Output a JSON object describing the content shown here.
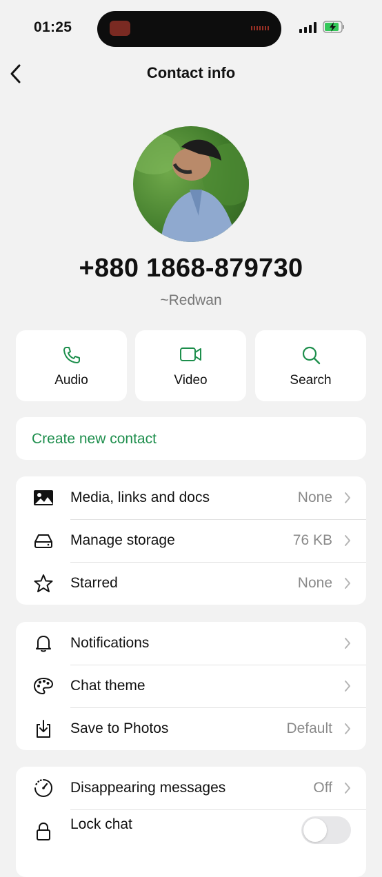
{
  "status_bar": {
    "time": "01:25"
  },
  "header": {
    "title": "Contact info"
  },
  "profile": {
    "phone": "+880 1868-879730",
    "name": "~Redwan"
  },
  "actions": [
    {
      "label": "Audio",
      "icon": "phone-icon"
    },
    {
      "label": "Video",
      "icon": "video-icon"
    },
    {
      "label": "Search",
      "icon": "search-icon"
    }
  ],
  "create_contact": {
    "label": "Create new contact"
  },
  "section1": [
    {
      "label": "Media, links and docs",
      "value": "None",
      "icon": "image-icon"
    },
    {
      "label": "Manage storage",
      "value": "76 KB",
      "icon": "storage-icon"
    },
    {
      "label": "Starred",
      "value": "None",
      "icon": "star-icon"
    }
  ],
  "section2": [
    {
      "label": "Notifications",
      "value": "",
      "icon": "bell-icon"
    },
    {
      "label": "Chat theme",
      "value": "",
      "icon": "palette-icon"
    },
    {
      "label": "Save to Photos",
      "value": "Default",
      "icon": "download-icon"
    }
  ],
  "section3": [
    {
      "label": "Disappearing messages",
      "value": "Off",
      "icon": "timer-icon"
    },
    {
      "label": "Lock chat",
      "value": "",
      "icon": "lock-icon",
      "toggle_on": false
    }
  ],
  "colors": {
    "accent": "#1d8e4c",
    "background": "#f2f2f2"
  }
}
